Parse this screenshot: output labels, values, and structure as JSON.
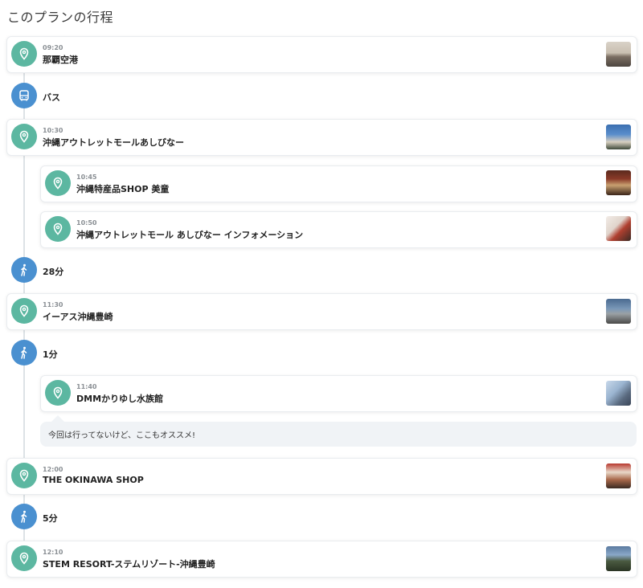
{
  "title": "このプランの行程",
  "memo_text": "今回は行ってないけど、ここもオススメ!",
  "colors": {
    "pin": "#5cb7a1",
    "transit": "#4a90d0"
  },
  "stops": [
    {
      "time": "09:20",
      "name": "那覇空港"
    },
    {
      "time": "10:30",
      "name": "沖縄アウトレットモールあしびなー"
    },
    {
      "time": "10:45",
      "name": "沖縄特産品SHOP 美童"
    },
    {
      "time": "10:50",
      "name": "沖縄アウトレットモール あしびなー インフォメーション"
    },
    {
      "time": "11:30",
      "name": "イーアス沖縄豊崎"
    },
    {
      "time": "11:40",
      "name": "DMMかりゆし水族館"
    },
    {
      "time": "12:00",
      "name": "THE OKINAWA SHOP"
    },
    {
      "time": "12:10",
      "name": "STEM RESORT-ステムリゾート-沖縄豊崎"
    }
  ],
  "transits": [
    {
      "icon": "bus-icon",
      "label": "バス"
    },
    {
      "icon": "walk-icon",
      "label": "28分"
    },
    {
      "icon": "walk-icon",
      "label": "1分"
    },
    {
      "icon": "walk-icon",
      "label": "5分"
    }
  ]
}
